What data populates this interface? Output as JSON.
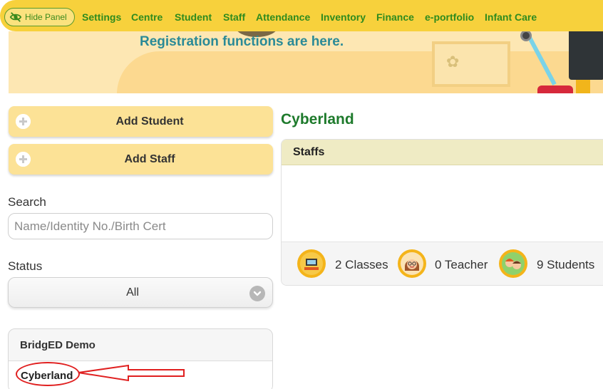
{
  "nav": {
    "hide_panel": "Hide Panel",
    "items": [
      "Settings",
      "Centre",
      "Student",
      "Staff",
      "Attendance",
      "Inventory",
      "Finance",
      "e-portfolio",
      "Infant Care"
    ]
  },
  "banner": {
    "title": "Registration functions are here."
  },
  "actions": {
    "add_student": "Add Student",
    "add_staff": "Add Staff"
  },
  "search": {
    "label": "Search",
    "placeholder": "Name/Identity No./Birth Cert",
    "value": ""
  },
  "status": {
    "label": "Status",
    "selected": "All"
  },
  "tree": {
    "organisation": "BridgED Demo",
    "centre": "Cyberland"
  },
  "main": {
    "centre_title": "Cyberland",
    "staffs_header": "Staffs",
    "stats": [
      {
        "icon": "classroom-icon",
        "text": "2 Classes"
      },
      {
        "icon": "teacher-icon",
        "text": "0 Teacher"
      },
      {
        "icon": "students-icon",
        "text": "9 Students"
      }
    ]
  },
  "colors": {
    "nav_bg": "#f7d13c",
    "nav_text": "#2f8b1e",
    "button_bg": "#fce296",
    "centre_title": "#1e7a2c",
    "annotation": "#e02020"
  }
}
